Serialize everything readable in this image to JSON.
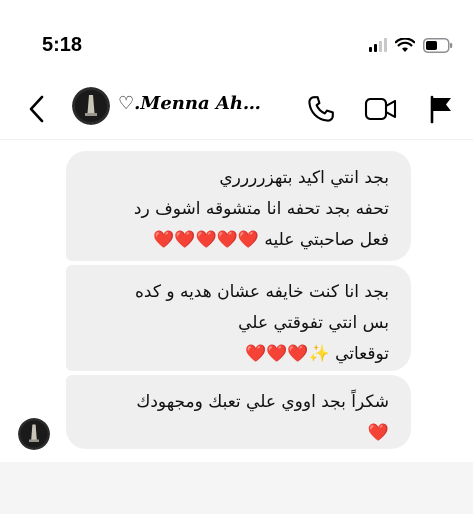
{
  "status_bar": {
    "time": "5:18",
    "signal_icon": "cellular-signal-icon",
    "wifi_icon": "wifi-icon",
    "battery_icon": "battery-icon"
  },
  "header": {
    "back_icon": "chevron-left-icon",
    "avatar_icon": "profile-avatar",
    "contact_name": "♡.Menna Ah…",
    "actions": {
      "call_icon": "phone-icon",
      "video_icon": "video-camera-icon",
      "report_icon": "flag-icon"
    }
  },
  "messages": [
    {
      "lines": [
        "بجد انتي اكيد بتهزرررري",
        "تحفه بجد تحفه انا متشوقه اشوف رد",
        "فعل صاحبتي عليه ❤️❤️❤️❤️❤️"
      ]
    },
    {
      "lines": [
        "بجد انا كنت خايفه عشان هديه و كده",
        "بس انتي تفوقتي علي",
        "توقعاتي ✨❤️❤️❤️"
      ]
    },
    {
      "lines": [
        "شكراً بجد اووي علي تعبك ومجهودك",
        "❤️"
      ]
    }
  ],
  "colors": {
    "bubble_background": "#efefef",
    "text": "#111111",
    "divider": "#efefef"
  }
}
